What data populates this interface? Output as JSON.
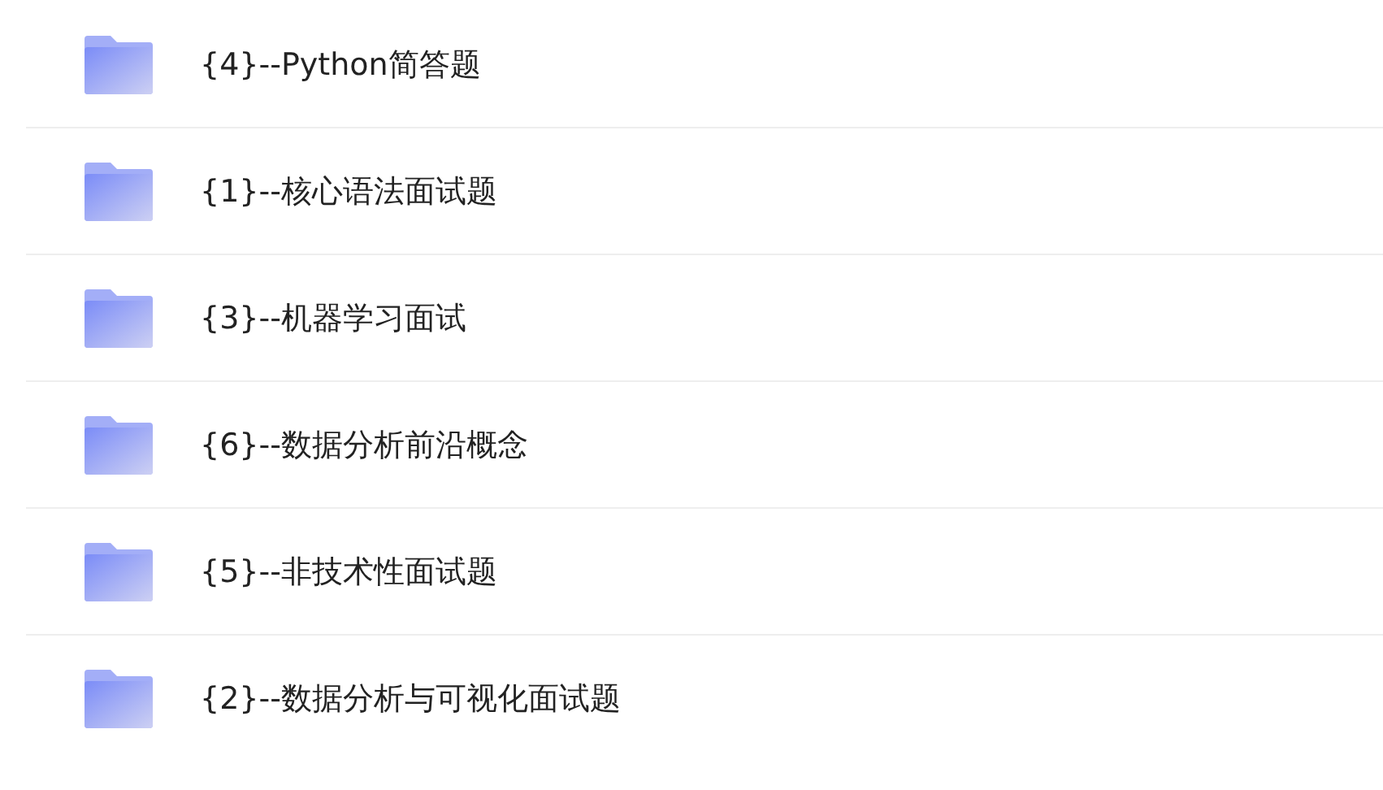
{
  "folders": [
    {
      "name": "{4}--Python简答题"
    },
    {
      "name": "{1}--核心语法面试题"
    },
    {
      "name": "{3}--机器学习面试"
    },
    {
      "name": "{6}--数据分析前沿概念"
    },
    {
      "name": "{5}--非技术性面试题"
    },
    {
      "name": "{2}--数据分析与可视化面试题"
    }
  ]
}
